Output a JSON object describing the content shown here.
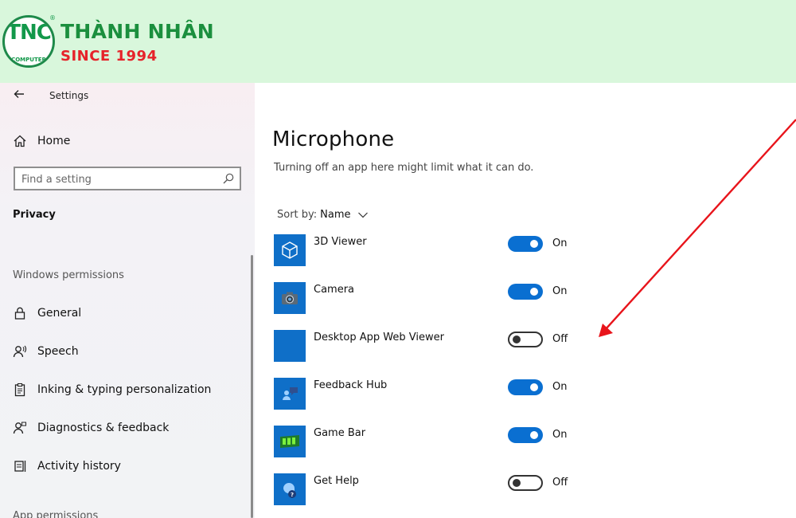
{
  "brand": {
    "logo_text": "TNC",
    "logo_subtext": "COMPUTER",
    "logo_reg": "®",
    "name": "THÀNH NHÂN",
    "since": "SINCE 1994",
    "banner_color": "#d9f7dc"
  },
  "header": {
    "back_icon": "back-arrow-icon",
    "title": "Settings"
  },
  "sidebar": {
    "home_label": "Home",
    "search_placeholder": "Find a setting",
    "category": "Privacy",
    "section_windows": "Windows permissions",
    "section_app": "App permissions",
    "items": [
      {
        "label": "General",
        "icon": "lock-icon"
      },
      {
        "label": "Speech",
        "icon": "speech-icon"
      },
      {
        "label": "Inking & typing personalization",
        "icon": "clipboard-icon"
      },
      {
        "label": "Diagnostics & feedback",
        "icon": "person-feedback-icon"
      },
      {
        "label": "Activity history",
        "icon": "activity-history-icon"
      }
    ]
  },
  "main": {
    "title": "Microphone",
    "description": "Turning off an app here might limit what it can do.",
    "sort_label": "Sort by:",
    "sort_value": "Name",
    "accent_color": "#0a6fd1",
    "apps": [
      {
        "name": "3D Viewer",
        "state": "On",
        "on": true,
        "icon": "cube-icon"
      },
      {
        "name": "Camera",
        "state": "On",
        "on": true,
        "icon": "camera-icon"
      },
      {
        "name": "Desktop App Web Viewer",
        "state": "Off",
        "on": false,
        "icon": "blank-tile-icon"
      },
      {
        "name": "Feedback Hub",
        "state": "On",
        "on": true,
        "icon": "feedback-hub-icon"
      },
      {
        "name": "Game Bar",
        "state": "On",
        "on": true,
        "icon": "game-bar-icon"
      },
      {
        "name": "Get Help",
        "state": "Off",
        "on": false,
        "icon": "get-help-icon"
      }
    ]
  },
  "annotation": {
    "color": "#e8141b"
  }
}
